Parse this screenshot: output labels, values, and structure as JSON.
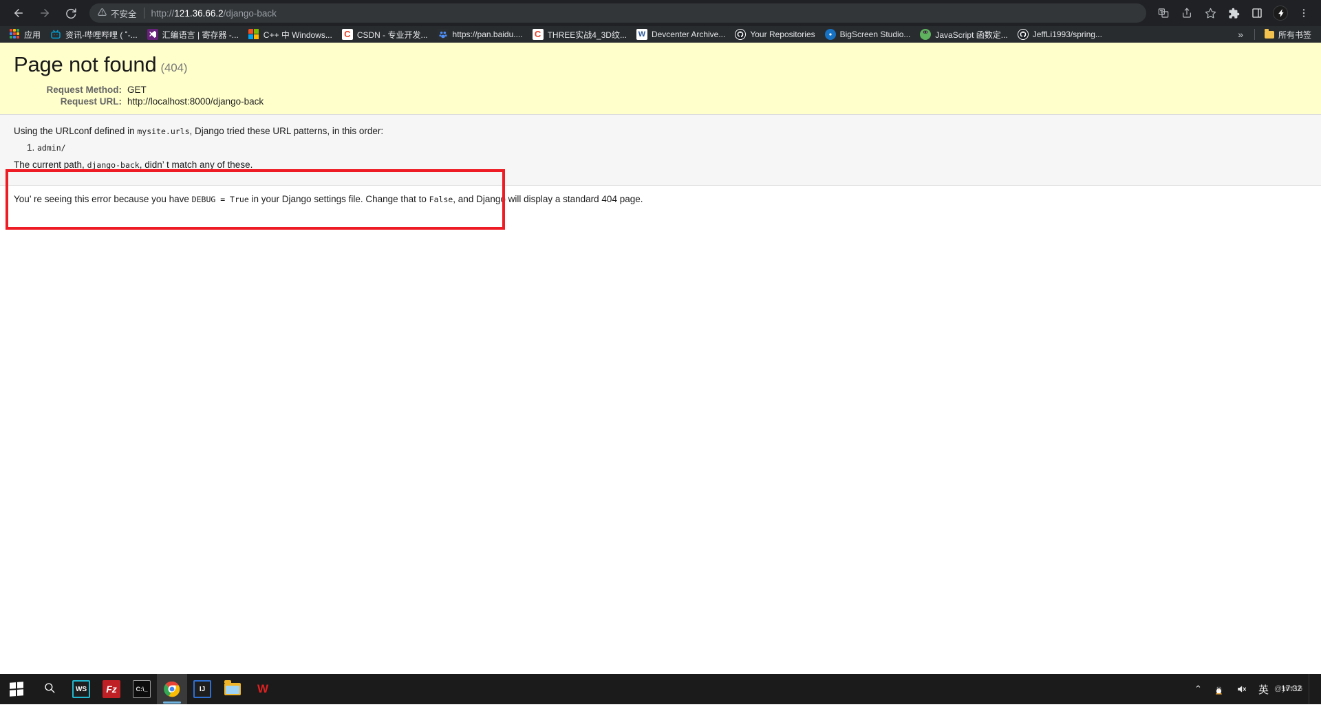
{
  "browser": {
    "nav": {
      "back_title": "Back",
      "forward_title": "Forward",
      "reload_title": "Reload"
    },
    "omnibox": {
      "security_label": "不安全",
      "url_scheme": "http://",
      "url_host": "121.36.66.2",
      "url_path": "/django-back",
      "full_url": "http://121.36.66.2/django-back"
    },
    "actions": [
      {
        "name": "translate-icon",
        "title": "翻译此页"
      },
      {
        "name": "share-icon",
        "title": "分享"
      },
      {
        "name": "bookmark-star-icon",
        "title": "将此标签页加入书签"
      },
      {
        "name": "extensions-puzzle-icon",
        "title": "扩展程序"
      },
      {
        "name": "side-panel-icon",
        "title": "侧边栏"
      },
      {
        "name": "profile-avatar",
        "title": "个人资料"
      },
      {
        "name": "chrome-menu-icon",
        "title": "自定义及控制"
      }
    ],
    "bookmarks": [
      {
        "label": "应用",
        "icon": "apps-grid-icon"
      },
      {
        "label": "资讯-哔哩哔哩 ( ˚-...",
        "icon": "bilibili-icon"
      },
      {
        "label": "汇编语言 | 寄存器 -...",
        "icon": "visualstudio-icon"
      },
      {
        "label": "C++ 中 Windows...",
        "icon": "microsoft-icon"
      },
      {
        "label": "CSDN - 专业开发...",
        "icon": "csdn-icon"
      },
      {
        "label": "https://pan.baidu....",
        "icon": "baidu-pan-icon"
      },
      {
        "label": "THREE实战4_3D纹...",
        "icon": "csdn-icon"
      },
      {
        "label": "Devcenter Archive...",
        "icon": "word-icon"
      },
      {
        "label": "Your Repositories",
        "icon": "github-icon"
      },
      {
        "label": "BigScreen Studio...",
        "icon": "bigscreen-icon"
      },
      {
        "label": "JavaScript 函数定...",
        "icon": "javascript-icon"
      },
      {
        "label": "JeffLi1993/spring...",
        "icon": "github-icon"
      }
    ],
    "bookmarks_overflow": {
      "chevron": "»",
      "all_bookmarks_label": "所有书签"
    }
  },
  "django": {
    "title": "Page not found",
    "status_code": "(404)",
    "meta_rows": [
      {
        "label": "Request Method:",
        "value": "GET"
      },
      {
        "label": "Request URL:",
        "value": "http://localhost:8000/django-back"
      }
    ],
    "urlconf_intro_before": "Using the URLconf defined in ",
    "urlconf_module": "mysite.urls",
    "urlconf_intro_after": ", Django tried these URL patterns, in this order:",
    "url_patterns": [
      "admin/"
    ],
    "current_path_before": "The current path, ",
    "current_path": "django-back",
    "current_path_after": ", didn’ t match any of these.",
    "explanation_part1": "You’ re seeing this error because you have ",
    "explanation_debug": "DEBUG = True",
    "explanation_part2": " in your Django settings file. Change that to ",
    "explanation_false": "False",
    "explanation_part3": ", and Django will display a standard 404 page.",
    "colors": {
      "summary_background": "#ffffcc",
      "info_background": "#f6f6f6",
      "annotation_border": "#ee1c25"
    }
  },
  "taskbar": {
    "start_label": "开始",
    "search_label": "搜索",
    "apps": [
      {
        "name": "webstorm",
        "glyph": "WS",
        "active": false
      },
      {
        "name": "filezilla",
        "glyph": "Fz",
        "active": false
      },
      {
        "name": "command-prompt",
        "glyph": "C:\\_",
        "active": false
      },
      {
        "name": "google-chrome",
        "glyph": "",
        "active": true
      },
      {
        "name": "intellij-idea",
        "glyph": "IJ",
        "active": false
      },
      {
        "name": "file-explorer",
        "glyph": "",
        "active": false
      },
      {
        "name": "wps-office",
        "glyph": "W",
        "active": false
      }
    ],
    "tray": {
      "chevron": "⌃",
      "qq_label": "QQ",
      "volume_label": "🔇",
      "ime_label": "英",
      "clock_time": "17:32",
      "watermark": "@ymt16"
    }
  }
}
